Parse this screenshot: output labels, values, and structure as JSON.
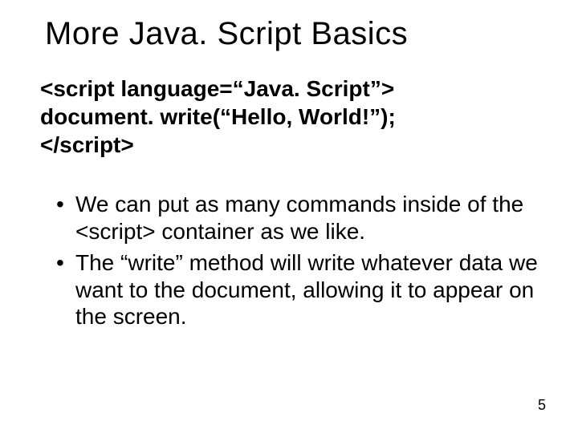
{
  "title": "More Java. Script Basics",
  "code": {
    "line1": "<script language=“Java. Script”>",
    "line2": "document. write(“Hello, World!”);",
    "line3": "</script>"
  },
  "bullets": [
    "We can put as many commands inside of the <script> container as we like.",
    "The “write” method will write whatever data we want to the document, allowing it to appear on the screen."
  ],
  "page_number": "5"
}
